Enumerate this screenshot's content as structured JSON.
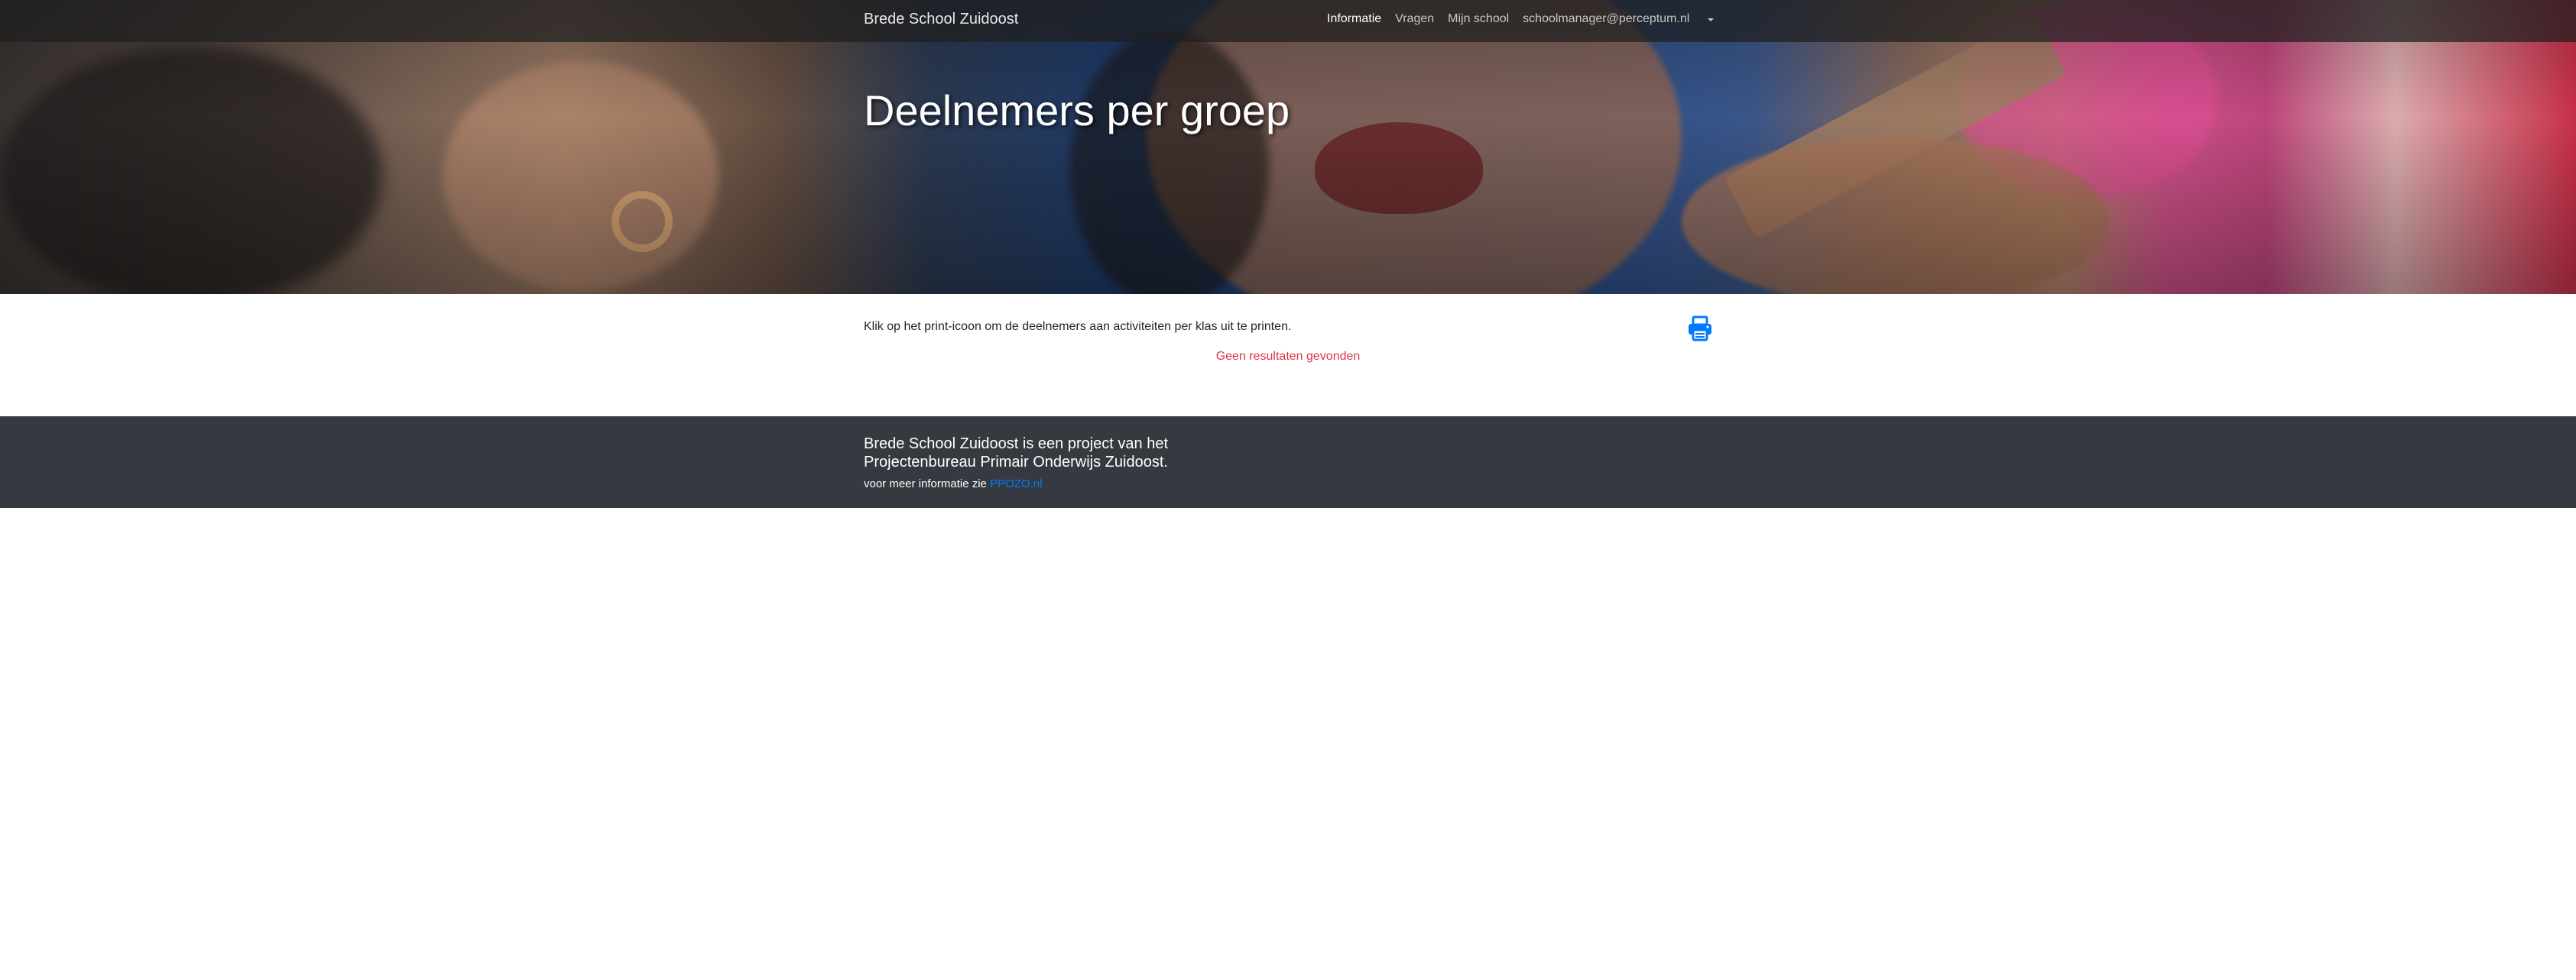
{
  "navbar": {
    "brand": "Brede School Zuidoost",
    "items": [
      {
        "label": "Informatie",
        "active": true
      },
      {
        "label": "Vragen",
        "active": false
      },
      {
        "label": "Mijn school",
        "active": false
      },
      {
        "label": "schoolmanager@perceptum.nl",
        "active": false
      }
    ]
  },
  "hero": {
    "title": "Deelnemers per groep"
  },
  "main": {
    "intro": "Klik op het print-icoon om de deelnemers aan activiteiten per klas uit te printen.",
    "print_icon": "print-icon",
    "no_results": "Geen resultaten gevonden"
  },
  "footer": {
    "title": "Brede School Zuidoost is een project van het Projectenbureau Primair Onderwijs Zuidoost.",
    "more_prefix": "voor meer informatie zie",
    "link_text": "PPOZO.nl"
  },
  "colors": {
    "accent": "#007bff",
    "danger": "#dc3545",
    "footer_bg": "#343a40"
  }
}
